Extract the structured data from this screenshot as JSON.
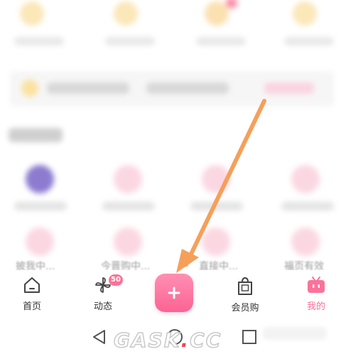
{
  "background_grid": {
    "row3_labels": [
      "披我中...",
      "今晋购中...",
      "直接中...",
      "福页有效"
    ]
  },
  "bottom_nav": {
    "items": [
      {
        "label": "首页",
        "icon": "home-icon",
        "active": false
      },
      {
        "label": "动态",
        "icon": "pinwheel-icon",
        "active": false,
        "badge": "50"
      },
      {
        "label": "会员购",
        "icon": "shopping-bag-icon",
        "active": false
      },
      {
        "label": "我的",
        "icon": "tv-icon",
        "active": true
      }
    ],
    "publish_button": {
      "icon": "plus-icon"
    }
  },
  "system_nav": {
    "back": "back-triangle-icon",
    "home": "home-circle-icon",
    "recent": "recent-square-icon"
  },
  "watermark": {
    "text_main": "GASK",
    "text_dot": ".",
    "text_tail": "CC"
  },
  "colors": {
    "accent": "#fb7299",
    "arrow": "#f5a05a"
  }
}
